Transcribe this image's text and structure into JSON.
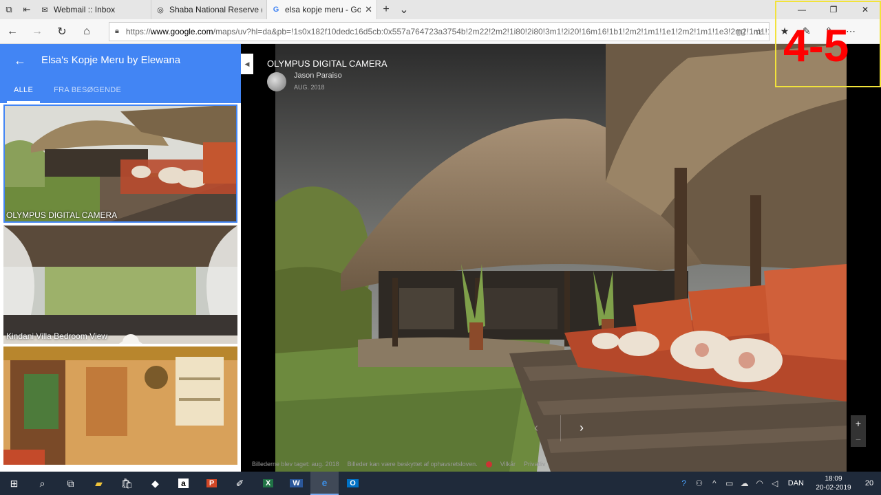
{
  "browser": {
    "tabs": [
      {
        "label": "Webmail :: Inbox",
        "favicon": "mail-icon"
      },
      {
        "label": "Shaba National Reserve (Sar",
        "favicon": "tripadvisor-icon"
      },
      {
        "label": "elsa kopje meru - Goog",
        "favicon": "google-icon",
        "active": true
      }
    ],
    "url_scheme": "https://",
    "url_host": "www.google.com",
    "url_path": "/maps/uv?hl=da&pb=!1s0x182f10dedc16d5cb:0x557a764723a3754b!2m22!2m2!1i80!2i80!3m1!2i20!16m16!1b1!2m2!1m1!1e1!2m2!1m1!1e3!2m2!1m1!1e5!2"
  },
  "sidebar": {
    "title": "Elsa's Kopje Meru by Elewana",
    "tabs": [
      "ALLE",
      "FRA BESØGENDE"
    ],
    "photos": [
      {
        "caption": "OLYMPUS DIGITAL CAMERA"
      },
      {
        "caption": "Kindani Villa Bedroom View"
      },
      {
        "caption": ""
      }
    ]
  },
  "viewer": {
    "title": "OLYMPUS DIGITAL CAMERA",
    "author": "Jason Paraiso",
    "date": "AUG. 2018",
    "footer": {
      "taken": "Billederne blev taget: aug. 2018",
      "copyright": "Billeder kan være beskyttet af ophavsretsloven.",
      "terms": "Vilkår",
      "privacy": "Privatliv"
    }
  },
  "annotation": {
    "text": "4-5",
    "color": "#ff0000",
    "border_color": "#f2e33b"
  },
  "taskbar": {
    "language": "DAN",
    "time": "18:09",
    "date": "20-02-2019",
    "notifications": "20"
  }
}
